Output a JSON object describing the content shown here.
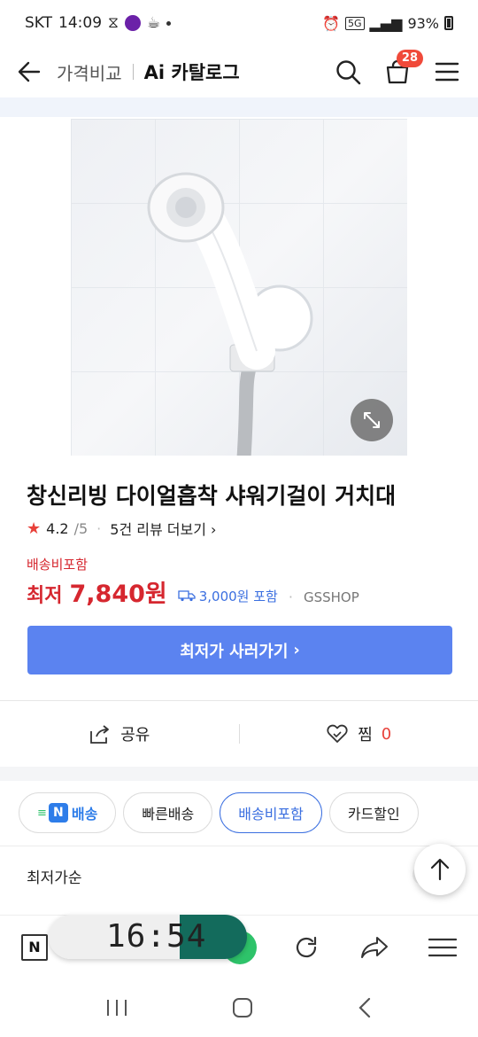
{
  "status_bar": {
    "carrier": "SKT",
    "time": "14:09",
    "battery": "93%",
    "network": "5G"
  },
  "header": {
    "breadcrumb": "가격비교",
    "title": "Ai 카탈로그",
    "cart_count": "28"
  },
  "product": {
    "name": "창신리빙 다이얼흡착 샤워기걸이 거치대",
    "rating": "4.2",
    "rating_max": "/5",
    "review_link": "5건 리뷰 더보기",
    "shipping_label": "배송비포함",
    "price_label": "최저",
    "price": "7,840원",
    "shipping_fee": "3,000원 포함",
    "shop": "GSSHOP",
    "buy_button": "최저가 사러가기"
  },
  "actions": {
    "share": "공유",
    "zzim": "찜",
    "zzim_count": "0"
  },
  "filters": {
    "chips": [
      "배송",
      "빠른배송",
      "배송비포함",
      "카드할인"
    ],
    "sort_label": "최저가순"
  },
  "browser": {
    "n_label": "N",
    "clock": "16:54"
  },
  "colors": {
    "accent_blue": "#5b83f0",
    "price_red": "#d6272f",
    "badge_red": "#f04a3a"
  }
}
